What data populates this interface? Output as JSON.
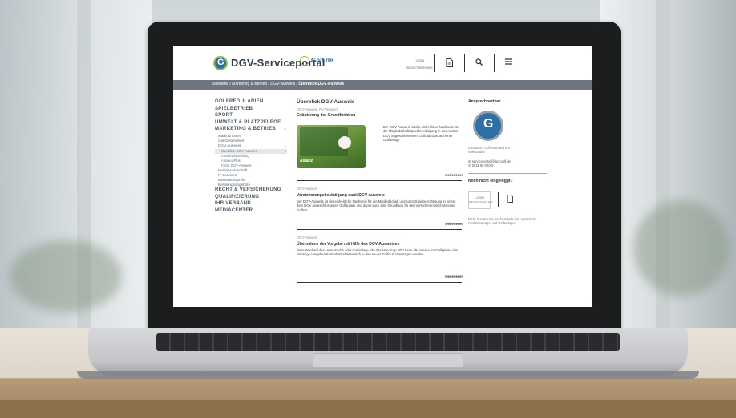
{
  "site": {
    "logo_text": "DGV-Serviceportal",
    "partner_logo": "Golf.de",
    "header": {
      "login_label": "LOGIN",
      "register_label": "REGISTRIERUNG",
      "doc_icon": "document-icon",
      "search_icon": "search-icon",
      "menu_icon": "hamburger-menu-icon"
    },
    "breadcrumb": {
      "path": "Startseite / Marketing & Betrieb / DGV-Ausweis / ",
      "current": "Überblick DGV-Ausweis"
    },
    "nav": {
      "main1": "GOLFREGULARIEN",
      "main2": "SPIELBETRIEB",
      "main3": "SPORT",
      "main4": "UMWELT & PLATZPFLEGE",
      "main5": "MARKETING & BETRIEB",
      "sub1": "Markt & Daten",
      "sub2": "GolfGesundheit",
      "sub3": "DGV-Ausweis",
      "subsub1": "Überblick DGV-Ausweis",
      "subsub2": "Ausweisbestellung",
      "subsub3": "AusweisPlus",
      "subsub4": "FAQs DGV-Ausweis",
      "sub4": "Betriebswirtschaft",
      "sub5": "IT-Services",
      "sub6": "Innovationspreis",
      "sub7": "Beratungsangebote",
      "main6": "RECHT & VERSICHERUNG",
      "main7": "QUALIFIZIERUNG",
      "main8": "IHR VERBAND",
      "main9": "MEDIACENTER"
    },
    "main": {
      "title": "Überblick DGV-Ausweis",
      "meta": "DGV-Ausweis, RV Verband",
      "section1_sub": "Erläuterung der Grundfunktion",
      "section1_text": "Der DGV-Ausweis ist der einheitliche Nachweis für die Mitgliedschaft/Spielberechtigung in einem dem DGV angeschlossenen Golfclub bzw. auf einer Golfanlage.",
      "card_brand": "Allianz",
      "read_more": "weiterlesen",
      "section2_meta": "DGV-Ausweis",
      "section2_title": "Versicherungsbestätigung dank DGV-Ausweis",
      "section2_text": "Der DGV-Ausweis ist der einheitliche Nachweis für die Mitgliedschaft und somit Spielberechtigung in einem dem DGV angeschlossenen Golfanlage und damit auch eine Grundlage für den Versicherungsschutz eines Golfers.",
      "section3_meta": "DGV-Ausweis",
      "section3_title": "Übernahme der Vorgabe mit Hilfe des DGV-Ausweises",
      "section3_text": "Beim Wechsel des Heimatclubs oder Golfanlage, die das Handicap führt kann als Service für Golfspieler das bisherige Vorgabenstammblatt elektronisch in den neuen Golfclub übertragen werden."
    },
    "aside": {
      "title": "Ansprechpartner",
      "org": "Deutscher Golf Verband e.V.",
      "city": "Wiesbaden",
      "email": "serviceportal@dgv.golf.de",
      "phone": "0611 99 020-0",
      "not_logged_title": "Noch nicht eingeloggt?",
      "login_label": "LOGIN",
      "register_label": "REGISTRIERUNG",
      "promo": "Mehr Funktionen, mehr Inhalte für registrierte Funktionsträger auf Golfanlagen"
    }
  }
}
